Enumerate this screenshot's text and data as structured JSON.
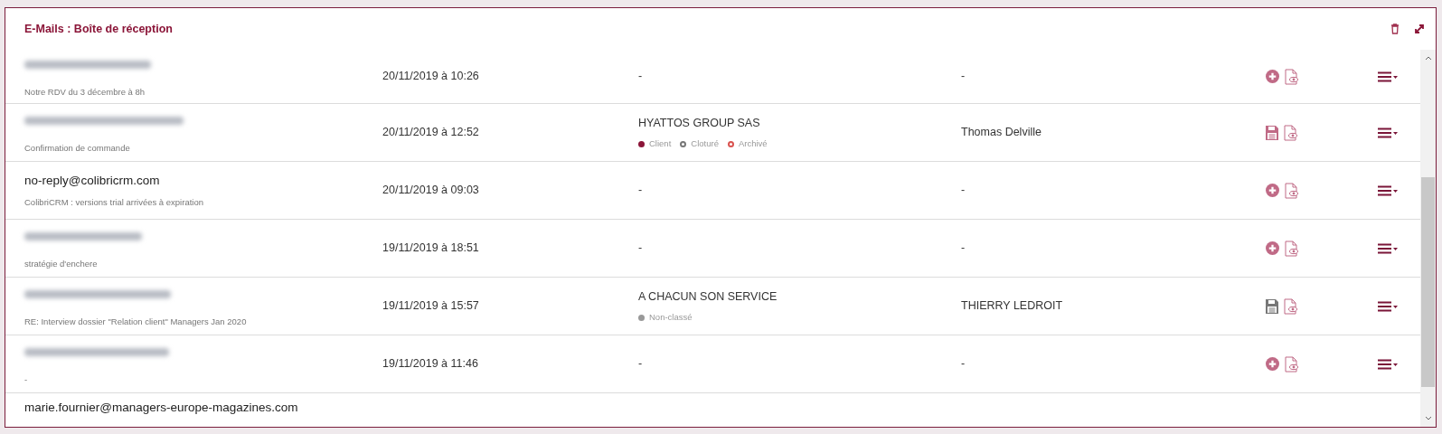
{
  "panel": {
    "title": "E-Mails : Boîte de réception"
  },
  "rows": [
    {
      "email_blurred": true,
      "subject": "Notre RDV du 3 décembre à 8h",
      "date": "20/11/2019 à 10:26",
      "company": "-",
      "contact": "-",
      "action": {
        "kind": "add"
      }
    },
    {
      "email_blurred": true,
      "subject": "Confirmation de commande",
      "date": "20/11/2019 à 12:52",
      "company": "HYATTOS GROUP SAS",
      "tags": [
        {
          "label": "Client",
          "kind": "filled",
          "color": "#8b1538"
        },
        {
          "label": "Cloturé",
          "kind": "ring",
          "color": "#777777"
        },
        {
          "label": "Archivé",
          "kind": "ring",
          "color": "#d9534f"
        }
      ],
      "contact": "Thomas Delville",
      "action": {
        "kind": "save",
        "active": true
      }
    },
    {
      "email": "no-reply@colibricrm.com",
      "subject": "ColibriCRM : versions trial arrivées à expiration",
      "date": "20/11/2019 à 09:03",
      "company": "-",
      "contact": "-",
      "action": {
        "kind": "add"
      }
    },
    {
      "email_blurred": true,
      "subject": "stratégie d'enchere",
      "date": "19/11/2019 à 18:51",
      "company": "-",
      "contact": "-",
      "action": {
        "kind": "add"
      }
    },
    {
      "email_blurred": true,
      "subject": "RE: Interview dossier \"Relation client\" Managers Jan 2020",
      "date": "19/11/2019 à 15:57",
      "company": "A CHACUN SON SERVICE",
      "tags": [
        {
          "label": "Non-classé",
          "kind": "filled",
          "color": "#999999"
        }
      ],
      "contact": "THIERRY LEDROIT",
      "action": {
        "kind": "save",
        "active": false
      }
    },
    {
      "email_blurred": true,
      "subject": "-",
      "date": "19/11/2019 à 11:46",
      "company": "-",
      "contact": "-",
      "action": {
        "kind": "add"
      }
    },
    {
      "email": "marie.fournier@managers-europe-magazines.com"
    }
  ]
}
